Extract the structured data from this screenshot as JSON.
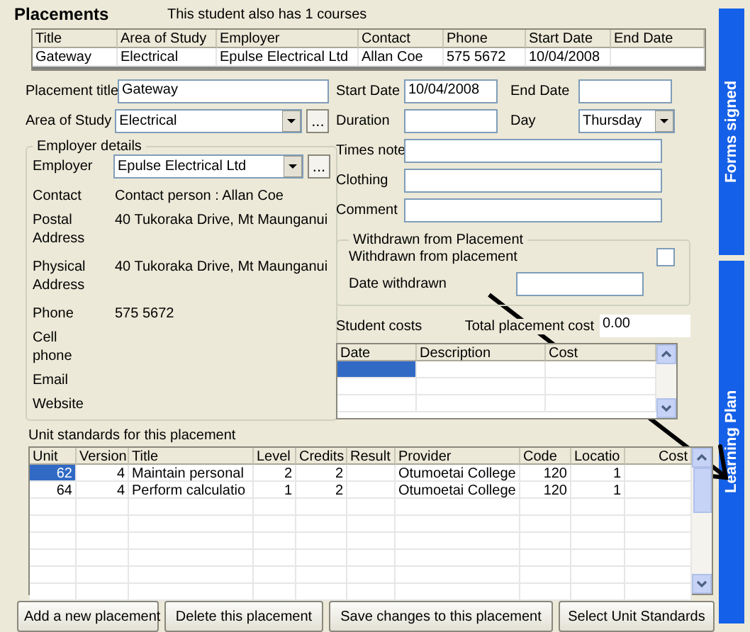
{
  "header": {
    "title": "Placements",
    "note": "This student also has 1 courses"
  },
  "placements_table": {
    "columns": [
      "Title",
      "Area of Study",
      "Employer",
      "Contact",
      "Phone",
      "Start Date",
      "End Date"
    ],
    "rows": [
      {
        "cells": [
          "Gateway",
          "Electrical",
          "Epulse Electrical Ltd",
          "Allan Coe",
          "575 5672",
          "10/04/2008",
          null
        ],
        "selected": false
      }
    ]
  },
  "placement_form": {
    "placement_title": {
      "label": "Placement title",
      "value": "Gateway"
    },
    "area_of_study": {
      "label": "Area of Study",
      "value": "Electrical",
      "browse_button": "..."
    },
    "employer_details": {
      "legend": "Employer details",
      "employer": {
        "label": "Employer",
        "value": "Epulse Electrical Ltd",
        "browse_button": "..."
      },
      "rows": [
        {
          "label": "Contact",
          "value": "Contact person : Allan Coe"
        },
        {
          "label": "Postal Address",
          "value": "40 Tukoraka Drive, Mt Maunganui"
        },
        {
          "label": "Physical Address",
          "value": "40 Tukoraka Drive, Mt Maunganui"
        },
        {
          "label": "Phone",
          "value": "575 5672"
        },
        {
          "label": "Cell phone"
        },
        {
          "label": "Email"
        },
        {
          "label": "Website"
        }
      ]
    },
    "start_date": {
      "label": "Start Date",
      "value": "10/04/2008"
    },
    "end_date": {
      "label": "End Date"
    },
    "duration": {
      "label": "Duration"
    },
    "day": {
      "label": "Day",
      "value": "Thursday"
    },
    "times_note": {
      "label": "Times note"
    },
    "clothing": {
      "label": "Clothing"
    },
    "comment": {
      "label": "Comment"
    },
    "withdrawn": {
      "legend": "Withdrawn from Placement",
      "checkbox": {
        "label": "Withdrawn from placement",
        "checked": false
      },
      "date_withdrawn": {
        "label": "Date withdrawn"
      }
    },
    "student_costs": {
      "label": "Student costs",
      "total_label": "Total placement cost",
      "total_value": "0.00",
      "columns": [
        "Date",
        "Description",
        "Cost"
      ],
      "rows": [
        {
          "selected": true
        },
        {
          "selected": false
        },
        {
          "selected": false
        }
      ]
    }
  },
  "unit_standards": {
    "label": "Unit standards for this placement",
    "columns": [
      {
        "title": "Unit",
        "numeric": true
      },
      {
        "title": "Version",
        "numeric": true
      },
      {
        "title": "Title",
        "numeric": false
      },
      {
        "title": "Level",
        "numeric": true
      },
      {
        "title": "Credits",
        "numeric": true
      },
      {
        "title": "Result"
      },
      {
        "title": "Provider",
        "numeric": false
      },
      {
        "title": "Code",
        "numeric": true
      },
      {
        "title": "Locatio",
        "numeric": true
      },
      {
        "title": "Cost"
      }
    ],
    "rows": [
      {
        "cells": [
          "62",
          "4",
          "Maintain personal",
          "2",
          "2",
          null,
          "Otumoetai College",
          "120",
          "1",
          null
        ],
        "selected": true
      },
      {
        "cells": [
          "64",
          "4",
          "Perform calculatio",
          "1",
          "2",
          null,
          "Otumoetai College",
          "120",
          "1",
          null
        ],
        "selected": false
      }
    ]
  },
  "buttons": [
    "Add a new placement",
    "Delete this placement",
    "Save changes to this placement",
    "Select Unit Standards"
  ],
  "side_tabs": [
    {
      "label": "Forms signed",
      "selected": false
    },
    {
      "label": "Learning Plan",
      "selected": false
    }
  ]
}
